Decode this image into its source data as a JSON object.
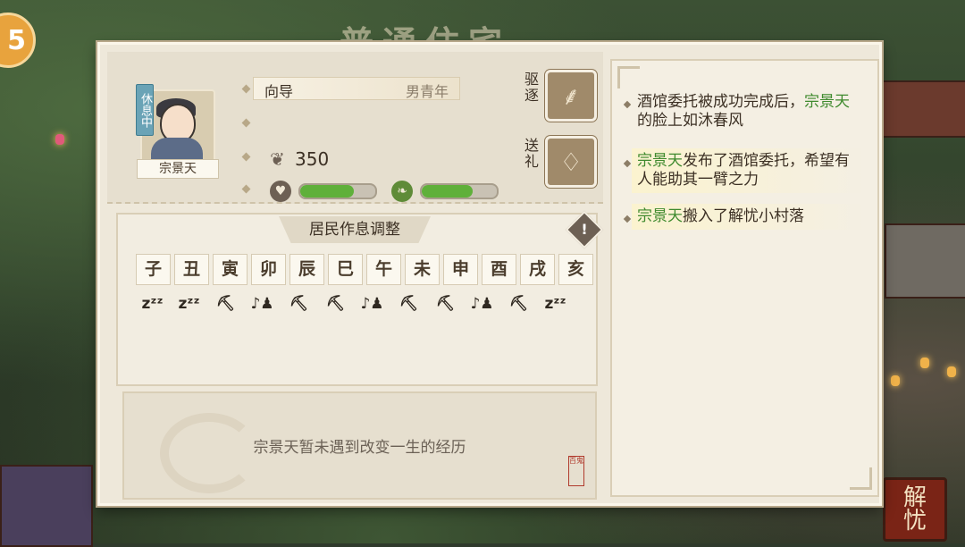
{
  "background": {
    "title": "普通住宅",
    "corner_button": "5",
    "jieyou_label": [
      "解",
      "忧"
    ]
  },
  "profile": {
    "name": "宗景天",
    "status_tag": "休息中",
    "role": "向导",
    "role_desc": "男青年",
    "coins": "350",
    "mood_fraction": 0.72,
    "health_fraction": 0.68,
    "actions": {
      "expel_label": "驱逐",
      "gift_label": "送礼"
    }
  },
  "schedule": {
    "title": "居民作息调整",
    "hours": [
      "子",
      "丑",
      "寅",
      "卯",
      "辰",
      "巳",
      "午",
      "未",
      "申",
      "酉",
      "戌",
      "亥"
    ],
    "activities": [
      "sleep",
      "sleep",
      "work",
      "leisure",
      "work",
      "work",
      "leisure",
      "work",
      "work",
      "leisure",
      "work",
      "sleep"
    ],
    "activity_icons": {
      "sleep": "zᶻᶻ",
      "work": "⛏",
      "leisure": "♪♟"
    }
  },
  "bio": {
    "text": "宗景天暂未遇到改变一生的经历",
    "seal": "百鬼"
  },
  "log": [
    {
      "pre": "酒馆委托被成功完成后，",
      "name": "宗景天",
      "post": "的脸上如沐春风",
      "highlight": false
    },
    {
      "pre": "",
      "name": "宗景天",
      "post": "发布了酒馆委托，希望有人能助其一臂之力",
      "highlight": true
    },
    {
      "pre": "",
      "name": "宗景天",
      "post": "搬入了解忧小村落",
      "highlight": true
    }
  ],
  "colors": {
    "accent_green": "#5fb03a",
    "name_green": "#3f8a2e",
    "panel": "#eee8da"
  }
}
